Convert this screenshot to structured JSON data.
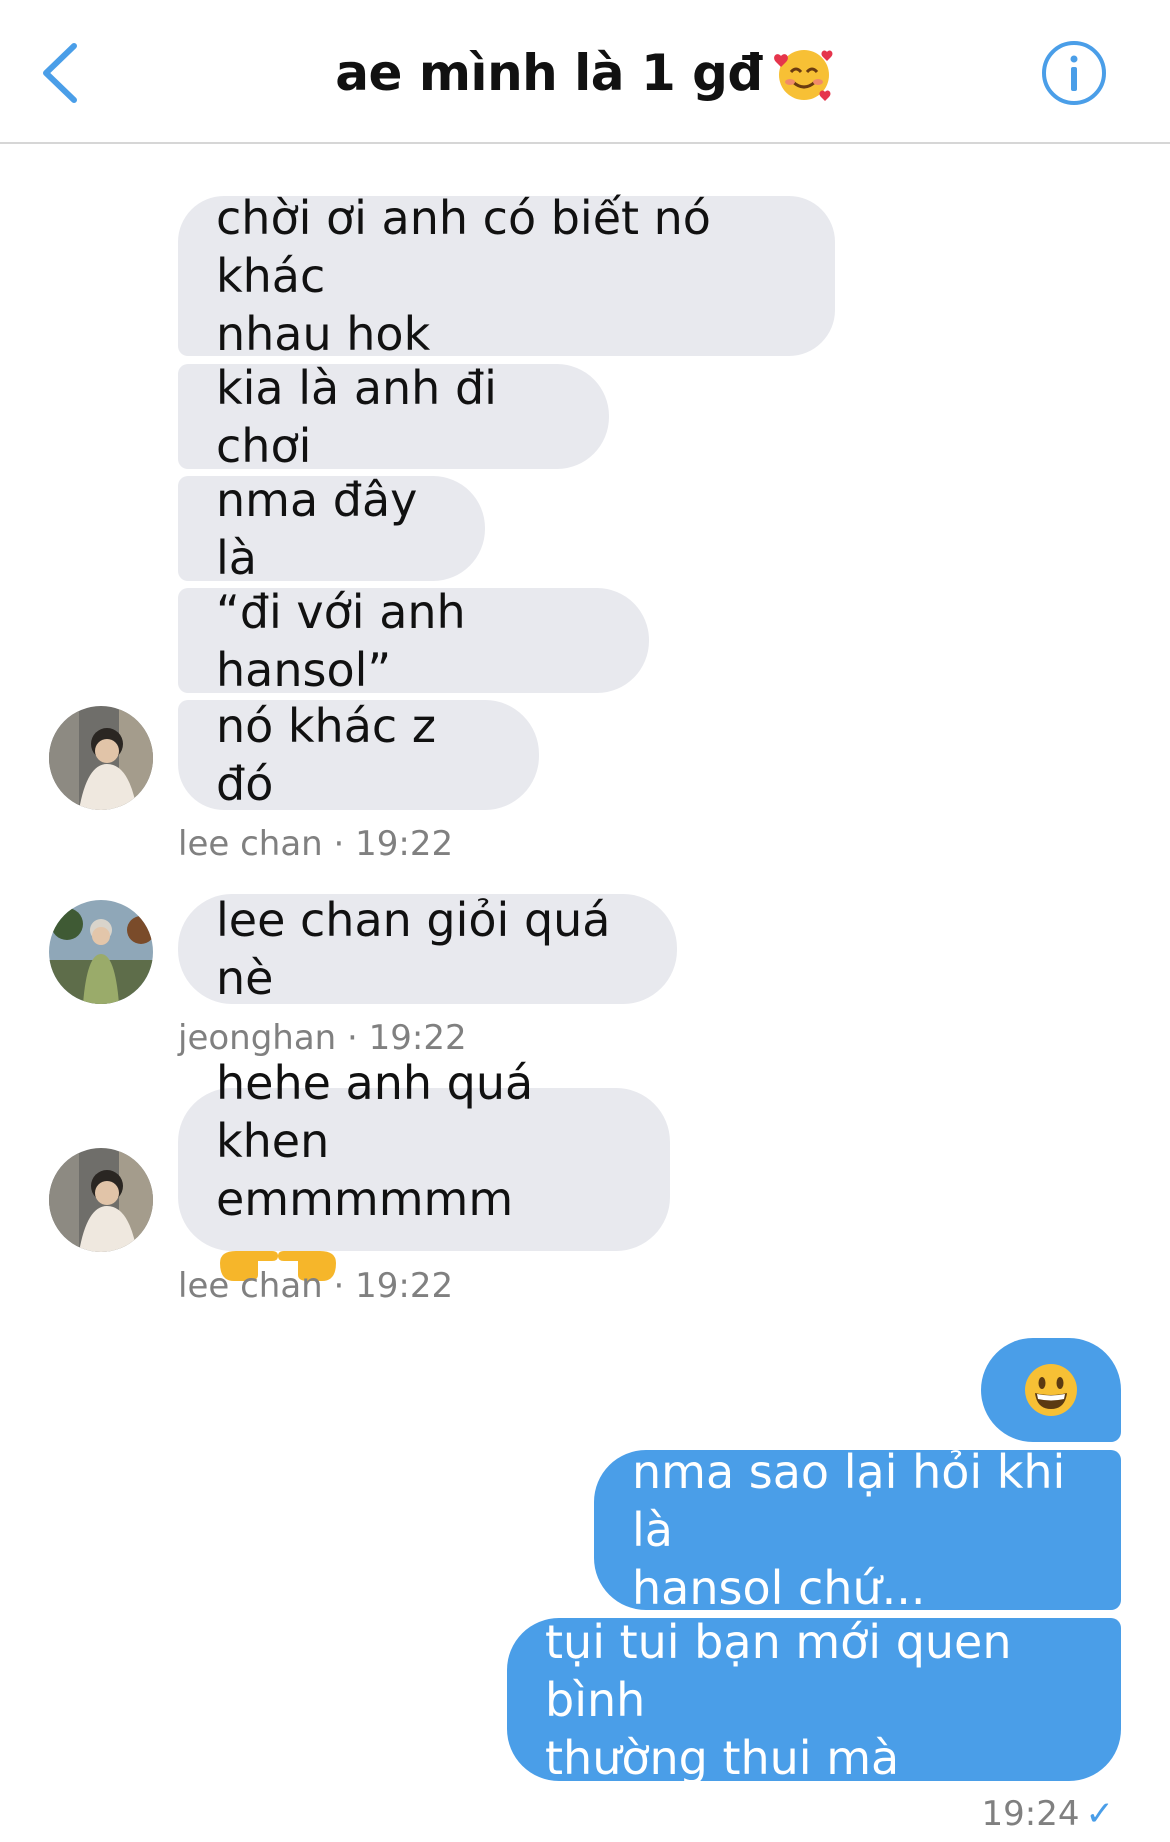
{
  "header": {
    "title": "ae mình là 1 gđ",
    "title_emoji": "smiling-face-with-hearts-emoji",
    "back_icon": "chevron-left-icon",
    "info_icon": "info-icon",
    "accent_color": "#4a9ee8"
  },
  "messages": {
    "m1": "chời ơi anh có biết nó khác\nnhau hok",
    "m2": "kia là anh đi chơi",
    "m3": "nma đây là",
    "m4": "“đi với anh hansol”",
    "m5": "nó khác z đó",
    "m6": "lee chan giỏi quá nè",
    "m7": "hehe anh quá khen\nemmmmmm",
    "m7_emoji": "pointing-hands-emoji",
    "m8_emoji": "grinning-face-emoji",
    "m9": "nma sao lại hỏi khi là\nhansol chứ...",
    "m10": "tụi tui bạn mới quen bình\nthường thui mà"
  },
  "meta": {
    "g1": "lee chan · 19:22",
    "g2": "jeonghan · 19:22",
    "g3": "lee chan · 19:22",
    "sent": "19:24",
    "sent_icon": "checkmark-icon"
  },
  "colors": {
    "incoming_bubble": "#e8e9ee",
    "outgoing_bubble": "#4a9ee8"
  }
}
